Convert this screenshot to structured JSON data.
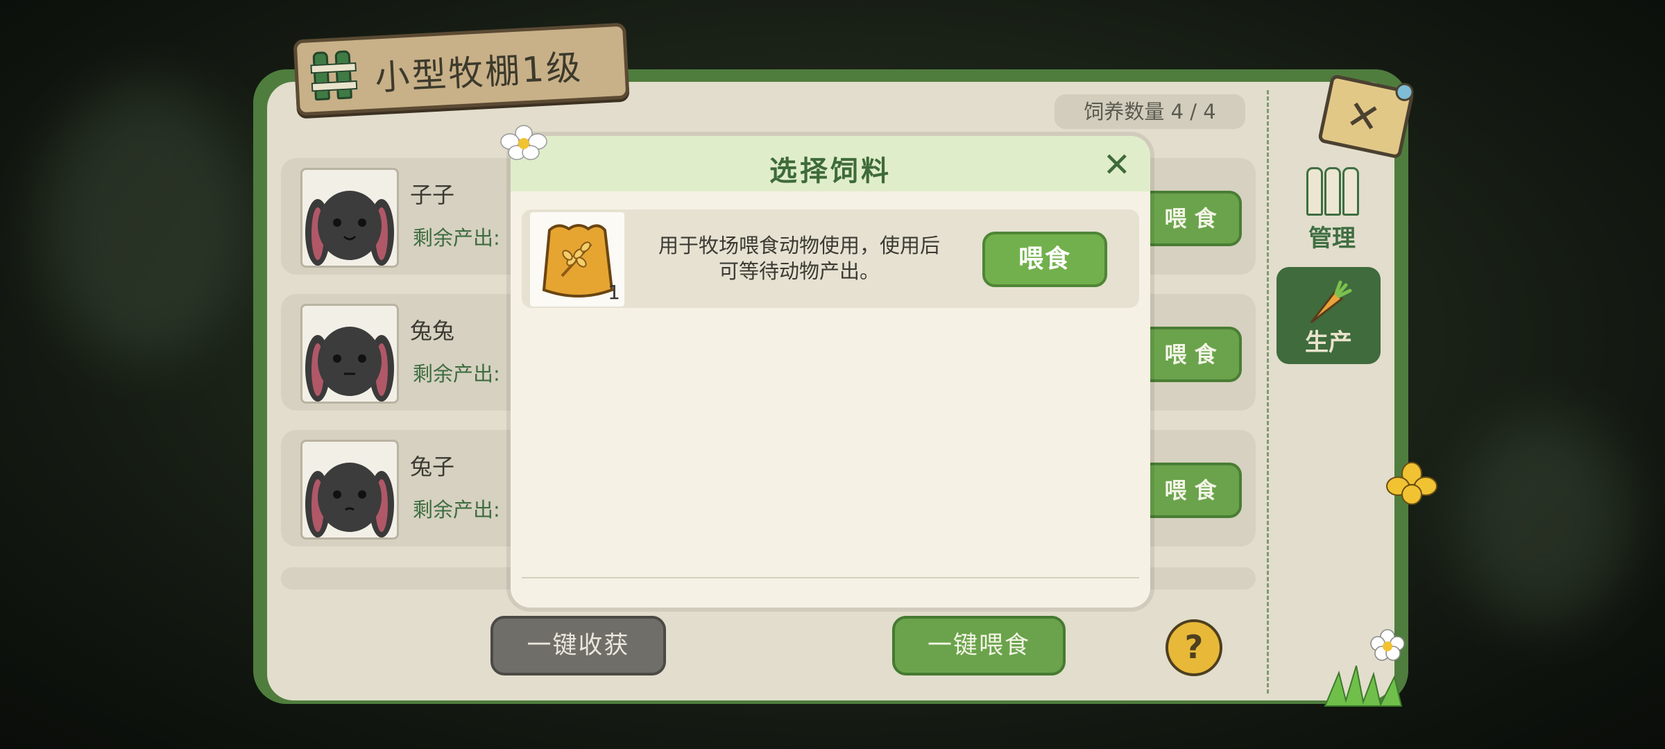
{
  "panel": {
    "title": "小型牧棚1级",
    "feed_count_label": "饲养数量",
    "feed_count_value": "4 / 4"
  },
  "sidebar": {
    "tabs": [
      {
        "label": "管理",
        "icon": "fence-icon"
      },
      {
        "label": "生产",
        "icon": "carrot-icon",
        "active": true
      }
    ]
  },
  "animals": [
    {
      "name": "子子",
      "remain_label": "剩余产出:",
      "feed_label": "喂 食"
    },
    {
      "name": "兔兔",
      "remain_label": "剩余产出:",
      "feed_label": "喂 食"
    },
    {
      "name": "兔子",
      "remain_label": "剩余产出:",
      "feed_label": "喂 食"
    }
  ],
  "bottom": {
    "harvest_all": "一键收获",
    "feed_all": "一键喂食",
    "help": "?"
  },
  "modal": {
    "title": "选择饲料",
    "close": "✕",
    "items": [
      {
        "icon": "feed-bag-icon",
        "quantity": "1",
        "desc_line1": "用于牧场喂食动物使用，使用后",
        "desc_line2": "可等待动物产出。",
        "button": "喂食"
      }
    ]
  },
  "colors": {
    "accent_green": "#6aa34b",
    "panel_green": "#4f7d3e",
    "panel_bg": "#e2ddcc",
    "modal_bg": "#f5f1e4",
    "help_yellow": "#e8b838"
  }
}
